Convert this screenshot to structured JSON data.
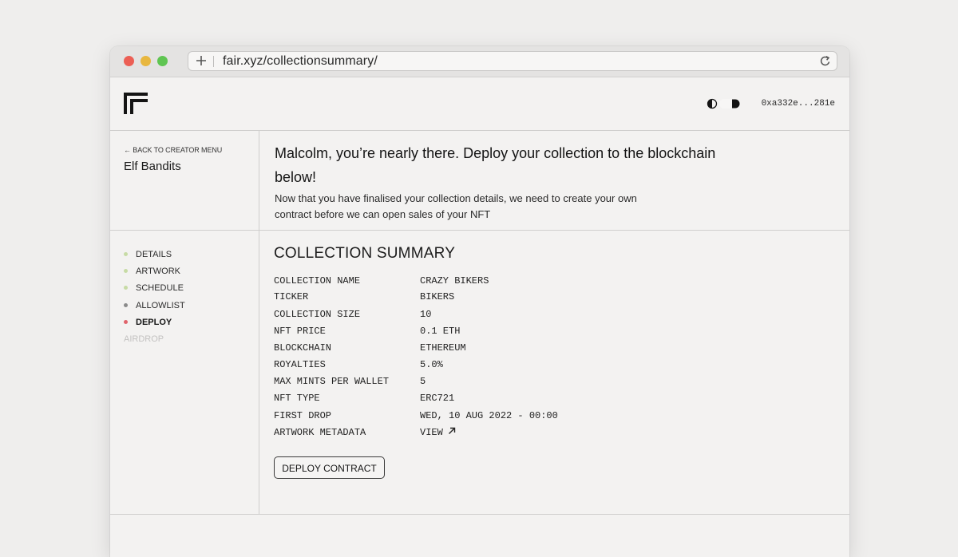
{
  "browser": {
    "url": "fair.xyz/collectionsummary/",
    "icons": {
      "new_tab": "plus-icon",
      "reload": "reload-icon"
    }
  },
  "header": {
    "logo": "fair-logo-icon",
    "theme_toggle": "contrast-toggle-icon",
    "wallet_address": "0xa332e...281e"
  },
  "sidebar": {
    "back_link": "← BACK TO CREATOR MENU",
    "collection_name": "Elf Bandits",
    "steps": [
      {
        "label": "DETAILS",
        "status": "done"
      },
      {
        "label": "ARTWORK",
        "status": "done"
      },
      {
        "label": "SCHEDULE",
        "status": "done"
      },
      {
        "label": "ALLOWLIST",
        "status": "pending"
      },
      {
        "label": "DEPLOY",
        "status": "active"
      },
      {
        "label": "AIRDROP",
        "status": "disabled"
      }
    ]
  },
  "intro": {
    "title": "Malcolm, you’re nearly there. Deploy your collection to the blockchain below!",
    "body": "Now that you have finalised your collection details, we need to create your own contract before we can open sales of your NFT"
  },
  "summary": {
    "title": "COLLECTION SUMMARY",
    "rows": [
      {
        "key": "COLLECTION NAME",
        "value": "CRAZY BIKERS"
      },
      {
        "key": "TICKER",
        "value": "BIKERS"
      },
      {
        "key": "COLLECTION SIZE",
        "value": "10"
      },
      {
        "key": "NFT PRICE",
        "value": "0.1 ETH"
      },
      {
        "key": "BLOCKCHAIN",
        "value": "ETHEREUM"
      },
      {
        "key": "ROYALTIES",
        "value": "5.0%"
      },
      {
        "key": "MAX MINTS PER WALLET",
        "value": "5"
      },
      {
        "key": "NFT TYPE",
        "value": "ERC721"
      },
      {
        "key": "FIRST DROP",
        "value": "WED, 10 AUG 2022 - 00:00"
      },
      {
        "key": "ARTWORK METADATA",
        "value": "VIEW",
        "icon": "arrow-up-right-icon"
      }
    ],
    "deploy_button": "DEPLOY CONTRACT"
  },
  "colors": {
    "step_done": "#c7dba5",
    "step_pending": "#8a8a8a",
    "step_active": "#e0636b",
    "step_disabled": "#c3c2c1"
  }
}
